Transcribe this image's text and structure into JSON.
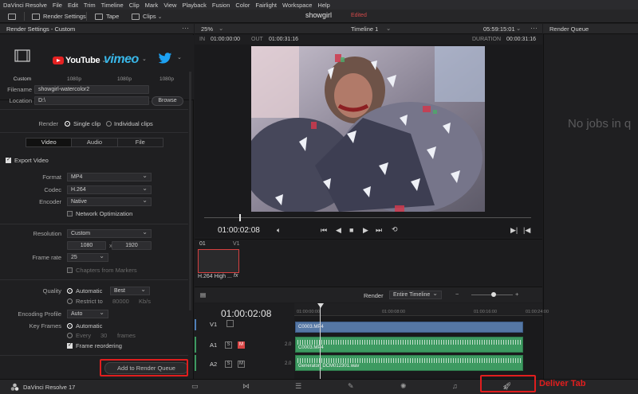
{
  "menu": [
    "DaVinci Resolve",
    "File",
    "Edit",
    "Trim",
    "Timeline",
    "Clip",
    "Mark",
    "View",
    "Playback",
    "Fusion",
    "Color",
    "Fairlight",
    "Workspace",
    "Help"
  ],
  "toolbar": {
    "render_settings": "Render Settings",
    "tape": "Tape",
    "clips": "Clips"
  },
  "project": {
    "name": "showgirl",
    "status": "Edited"
  },
  "render_settings": {
    "title": "Render Settings - Custom",
    "presets": [
      {
        "name": "Custom",
        "sub": ""
      },
      {
        "name": "YouTube",
        "sub": "1080p"
      },
      {
        "name": "vimeo",
        "sub": "1080p"
      },
      {
        "name": "Twitter",
        "sub": "1080p"
      }
    ],
    "filename_label": "Filename",
    "filename": "showgirl-watercolor2",
    "location_label": "Location",
    "location": "D:\\",
    "browse": "Browse",
    "render_label": "Render",
    "single_clip": "Single clip",
    "individual_clips": "Individual clips",
    "tabs": [
      "Video",
      "Audio",
      "File"
    ],
    "export_video": "Export Video",
    "format_label": "Format",
    "format": "MP4",
    "codec_label": "Codec",
    "codec": "H.264",
    "encoder_label": "Encoder",
    "encoder": "Native",
    "network_opt": "Network Optimization",
    "resolution_label": "Resolution",
    "resolution": "Custom",
    "res_w": "1080",
    "res_x": "x",
    "res_h": "1920",
    "framerate_label": "Frame rate",
    "framerate": "25",
    "chapters": "Chapters from Markers",
    "quality_label": "Quality",
    "quality_auto": "Automatic",
    "quality_value": "Best",
    "restrict_to": "Restrict to",
    "restrict_val": "80000",
    "restrict_unit": "Kb/s",
    "enc_profile_label": "Encoding Profile",
    "enc_profile": "Auto",
    "keyframes_label": "Key Frames",
    "kf_auto": "Automatic",
    "kf_every": "Every",
    "kf_val": "30",
    "kf_unit": "frames",
    "frame_reorder": "Frame reordering",
    "add_to_queue": "Add to Render Queue"
  },
  "viewer": {
    "zoom": "25%",
    "timeline": "Timeline 1",
    "timecode_top": "05:59:15:01",
    "in_label": "IN",
    "in": "01:00:00:00",
    "out_label": "OUT",
    "out": "01:00:31:16",
    "duration_label": "DURATION",
    "duration": "00:00:31:16",
    "current_tc": "01:00:02:08"
  },
  "render_queue": {
    "title": "Render Queue",
    "empty": "No jobs in q"
  },
  "clips": {
    "index": "01",
    "track": "V1",
    "clip_name": "H.264 High ...",
    "fx": "fx"
  },
  "timeline": {
    "render_label": "Render",
    "render_mode": "Entire Timeline",
    "timecode": "01:00:02:08",
    "ruler": [
      "01:00:00:00",
      "01:00:08:00",
      "01:00:16:00",
      "01:00:24:00"
    ],
    "tracks": [
      {
        "name": "V1",
        "clip": "C0003.MP4"
      },
      {
        "name": "A1",
        "clip": "C0003.MP4",
        "level": "2.0"
      },
      {
        "name": "A2",
        "clip": "Generator_DCM012301.wav",
        "level": "2.0"
      }
    ]
  },
  "bottom": {
    "app": "DaVinci Resolve 17",
    "deliver_annotation": "Deliver Tab"
  },
  "accent_red": "#e01e1e"
}
